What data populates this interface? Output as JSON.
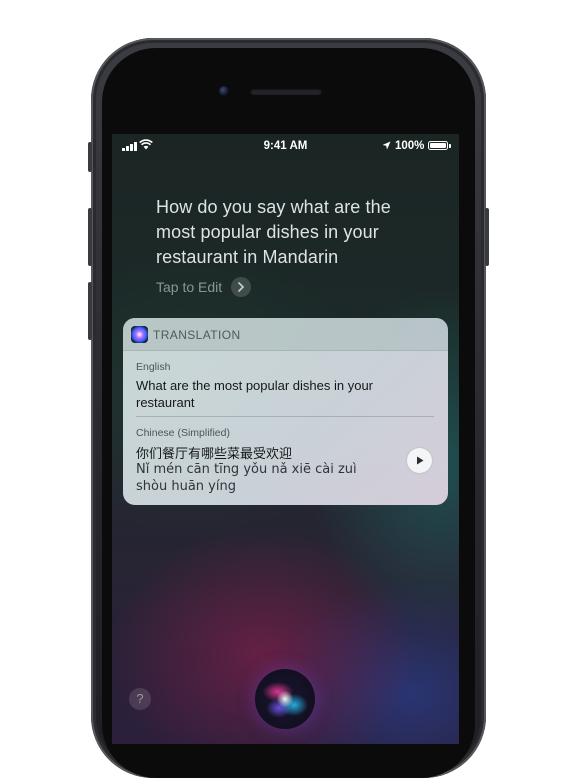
{
  "status_bar": {
    "time": "9:41 AM",
    "battery": "100%"
  },
  "siri": {
    "query": "How do you say what are the most popular dishes in your restaurant in Mandarin",
    "tap_to_edit": "Tap to Edit"
  },
  "translation_card": {
    "title": "TRANSLATION",
    "source_language": "English",
    "source_text": "What are the most popular dishes in your restaurant",
    "target_language": "Chinese (Simplified)",
    "target_text": "你们餐厅有哪些菜最受欢迎",
    "pinyin": "Nǐ mén cān tīng yǒu nǎ xiē cài zuì shòu huān yíng"
  },
  "help_label": "?",
  "colors": {
    "card_background": "#d6e2e2",
    "card_header": "#aab9b9",
    "query_text": "#dfe3e2",
    "tap_text": "#8a9694"
  }
}
